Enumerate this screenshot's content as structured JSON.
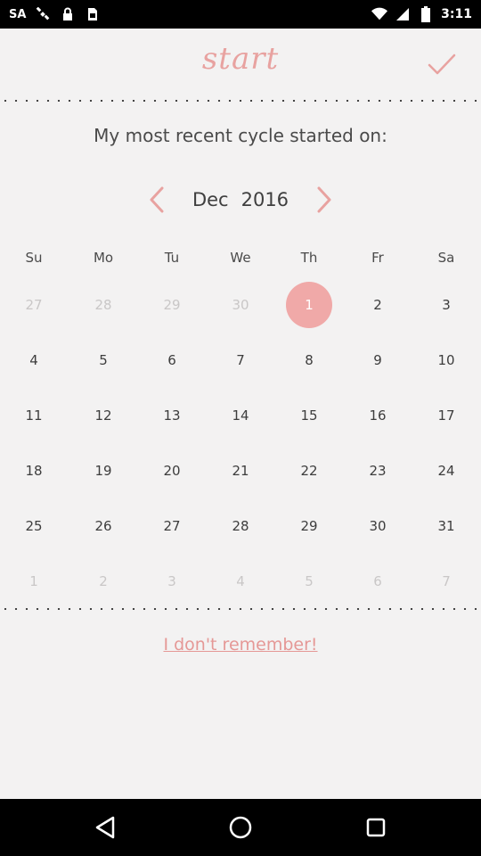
{
  "status_bar": {
    "left_items": [
      "SA"
    ],
    "icons": [
      "satellite-icon",
      "lock-icon",
      "sim-icon"
    ],
    "right_icons": [
      "wifi-icon",
      "signal-icon",
      "battery-icon"
    ],
    "time": "3:11"
  },
  "header": {
    "title": "start",
    "confirm_icon": "check-icon"
  },
  "prompt": "My most recent cycle started on:",
  "month_nav": {
    "month": "Dec",
    "year": "2016",
    "prev_icon": "chevron-left-icon",
    "next_icon": "chevron-right-icon"
  },
  "weekdays": [
    "Su",
    "Mo",
    "Tu",
    "We",
    "Th",
    "Fr",
    "Sa"
  ],
  "weeks": [
    [
      {
        "d": "27",
        "muted": true
      },
      {
        "d": "28",
        "muted": true
      },
      {
        "d": "29",
        "muted": true
      },
      {
        "d": "30",
        "muted": true
      },
      {
        "d": "1",
        "selected": true
      },
      {
        "d": "2"
      },
      {
        "d": "3"
      }
    ],
    [
      {
        "d": "4"
      },
      {
        "d": "5"
      },
      {
        "d": "6"
      },
      {
        "d": "7"
      },
      {
        "d": "8"
      },
      {
        "d": "9"
      },
      {
        "d": "10"
      }
    ],
    [
      {
        "d": "11"
      },
      {
        "d": "12"
      },
      {
        "d": "13"
      },
      {
        "d": "14"
      },
      {
        "d": "15"
      },
      {
        "d": "16"
      },
      {
        "d": "17"
      }
    ],
    [
      {
        "d": "18"
      },
      {
        "d": "19"
      },
      {
        "d": "20"
      },
      {
        "d": "21"
      },
      {
        "d": "22"
      },
      {
        "d": "23"
      },
      {
        "d": "24"
      }
    ],
    [
      {
        "d": "25"
      },
      {
        "d": "26"
      },
      {
        "d": "27"
      },
      {
        "d": "28"
      },
      {
        "d": "29"
      },
      {
        "d": "30"
      },
      {
        "d": "31"
      }
    ],
    [
      {
        "d": "1",
        "muted": true
      },
      {
        "d": "2",
        "muted": true
      },
      {
        "d": "3",
        "muted": true
      },
      {
        "d": "4",
        "muted": true
      },
      {
        "d": "5",
        "muted": true
      },
      {
        "d": "6",
        "muted": true
      },
      {
        "d": "7",
        "muted": true
      }
    ]
  ],
  "dont_remember_label": "I don't remember!",
  "colors": {
    "accent": "#e8a2a0",
    "selected_day": "#f0a9a8",
    "text": "#3d3d3d",
    "muted": "#c9c7c7"
  },
  "nav_bar": {
    "back_icon": "back-triangle-icon",
    "home_icon": "home-circle-icon",
    "recents_icon": "recents-square-icon"
  }
}
